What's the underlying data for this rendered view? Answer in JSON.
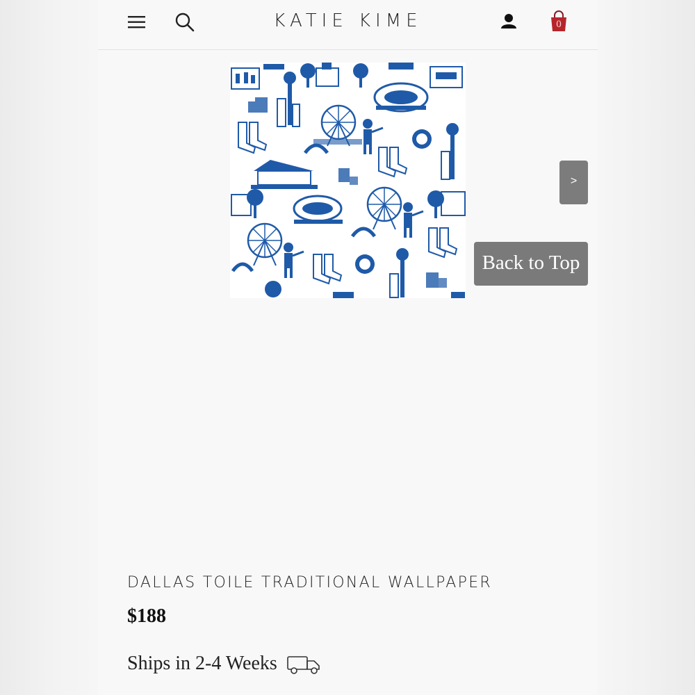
{
  "header": {
    "brand": "KATIE KIME",
    "cart_count": "0",
    "icons": {
      "menu": "hamburger-menu-icon",
      "search": "search-icon",
      "account": "account-icon",
      "cart": "shopping-bag-icon"
    }
  },
  "gallery": {
    "next_label": ">",
    "image_description_icon": "dallas-toile-wallpaper-pattern"
  },
  "back_to_top_label": "Back to Top",
  "product": {
    "title": "DALLAS TOILE TRADITIONAL WALLPAPER",
    "price": "$188",
    "shipping": "Ships in 2-4 Weeks",
    "shipping_icon": "truck-icon"
  },
  "colors": {
    "toile_blue": "#1f5aa8",
    "cart_red": "#b5262b",
    "button_gray": "#7a7a7a"
  }
}
